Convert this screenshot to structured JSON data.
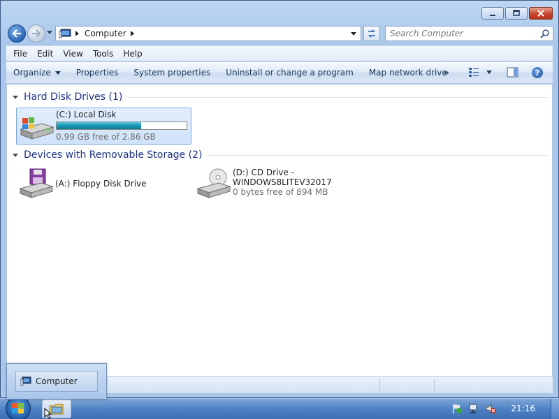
{
  "window": {
    "title": "Computer"
  },
  "navigation": {
    "breadcrumb": [
      "Computer"
    ],
    "search_placeholder": "Search Computer"
  },
  "menu": [
    "File",
    "Edit",
    "View",
    "Tools",
    "Help"
  ],
  "command_bar": {
    "organize": "Organize",
    "properties": "Properties",
    "system_properties": "System properties",
    "uninstall": "Uninstall or change a program",
    "map_drive": "Map network drive",
    "more": "»",
    "help": "?"
  },
  "groups": {
    "hard_disks": {
      "header": "Hard Disk Drives (1)",
      "drives": [
        {
          "name": "(C:) Local Disk",
          "free": "0.99 GB free of 2.86 GB",
          "used_fraction": 0.65
        }
      ]
    },
    "removable": {
      "header": "Devices with Removable Storage (2)",
      "floppy": {
        "name": "(A:) Floppy Disk Drive"
      },
      "cd": {
        "name_line1": "(D:) CD Drive -",
        "name_line2": "WINDOWS8LITEV32017",
        "free": "0 bytes free of 894 MB"
      }
    }
  },
  "taskbar": {
    "clock": "21:16",
    "thumbnail_label": "Computer"
  },
  "colors": {
    "accent": "#1e3287",
    "progress": "#1895b2",
    "close": "#c8452f"
  }
}
